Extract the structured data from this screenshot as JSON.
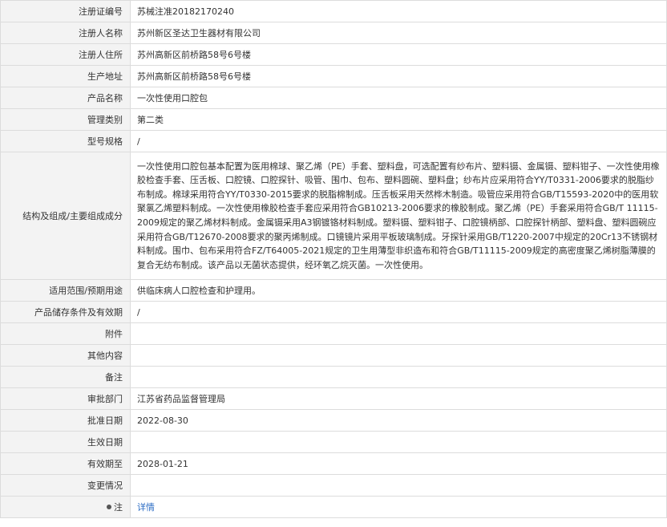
{
  "rows": [
    {
      "label": "注册证编号",
      "value": "苏械注准20182170240"
    },
    {
      "label": "注册人名称",
      "value": "苏州新区圣达卫生器材有限公司"
    },
    {
      "label": "注册人住所",
      "value": "苏州高新区前桥路58号6号楼"
    },
    {
      "label": "生产地址",
      "value": "苏州高新区前桥路58号6号楼"
    },
    {
      "label": "产品名称",
      "value": "一次性使用口腔包"
    },
    {
      "label": "管理类别",
      "value": "第二类"
    },
    {
      "label": "型号规格",
      "value": "/"
    },
    {
      "label": "结构及组成/主要组成成分",
      "value": "一次性使用口腔包基本配置为医用棉球、聚乙烯（PE）手套、塑料盘，可选配置有纱布片、塑料镊、金属镊、塑料钳子、一次性使用橡胶检查手套、压舌板、口腔镜、口腔探针、吸管、围巾、包布、塑料圆碗、塑料盘；纱布片应采用符合YY/T0331-2006要求的脱脂纱布制成。棉球采用符合YY/T0330-2015要求的脱脂棉制成。压舌板采用天然桦木制造。吸管应采用符合GB/T15593-2020中的医用软聚氯乙烯塑料制成。一次性使用橡胶检查手套应采用符合GB10213-2006要求的橡胶制成。聚乙烯（PE）手套采用符合GB/T 11115-2009规定的聚乙烯材料制成。金属镊采用A3钢镀铬材料制成。塑料镊、塑料钳子、口腔镜柄部、口腔探针柄部、塑料盘、塑料圆碗应采用符合GB/T12670-2008要求的聚丙烯制成。口镜镜片采用平板玻璃制成。牙探针采用GB/T1220-2007中规定的20Cr13不锈钢材料制成。围巾、包布采用符合FZ/T64005-2021规定的卫生用薄型非织造布和符合GB/T11115-2009规定的高密度聚乙烯树脂薄膜的复合无纺布制成。该产品以无菌状态提供，经环氧乙烷灭菌。一次性使用。"
    },
    {
      "label": "适用范围/预期用途",
      "value": "供临床病人口腔检查和护理用。"
    },
    {
      "label": "产品储存条件及有效期",
      "value": "/"
    },
    {
      "label": "附件",
      "value": ""
    },
    {
      "label": "其他内容",
      "value": ""
    },
    {
      "label": "备注",
      "value": ""
    },
    {
      "label": "审批部门",
      "value": "江苏省药品监督管理局"
    },
    {
      "label": "批准日期",
      "value": "2022-08-30"
    },
    {
      "label": "生效日期",
      "value": ""
    },
    {
      "label": "有效期至",
      "value": "2028-01-21"
    },
    {
      "label": "变更情况",
      "value": ""
    }
  ],
  "note": {
    "label": "注",
    "link_text": "详情",
    "icon": "pin-icon"
  }
}
